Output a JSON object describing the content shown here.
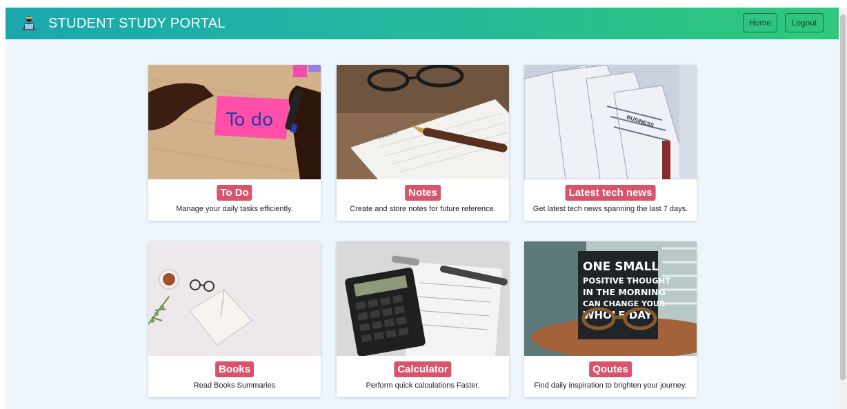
{
  "navbar": {
    "brand": "STUDENT STUDY PORTAL",
    "brand_icon": "student-laptop-icon",
    "home_label": "Home",
    "logout_label": "Logout"
  },
  "cards": [
    {
      "title": "To Do",
      "description": "Manage your daily tasks efficiently.",
      "image_text": "To do"
    },
    {
      "title": "Notes",
      "description": "Create and store notes for future reference.",
      "image_text": "Notes"
    },
    {
      "title": "Latest tech news",
      "description": "Get latest tech news spanning the last 7 days.",
      "image_text": "BUSINESS"
    },
    {
      "title": "Books",
      "description": "Read Books Summaries"
    },
    {
      "title": "Calculator",
      "description": "Perform quick calculations Faster."
    },
    {
      "title": "Qoutes",
      "description": "Find daily inspiration to brighten your journey.",
      "image_lines": [
        "ONE SMALL",
        "POSITIVE THOUGHT",
        "IN THE MORNING",
        "CAN CHANGE YOUR",
        "WHOLE DAY"
      ]
    }
  ],
  "colors": {
    "accent": "#d9536a",
    "navbar_start": "#1ba6ad",
    "navbar_end": "#30c87b",
    "page_bg": "#eef6fd"
  }
}
